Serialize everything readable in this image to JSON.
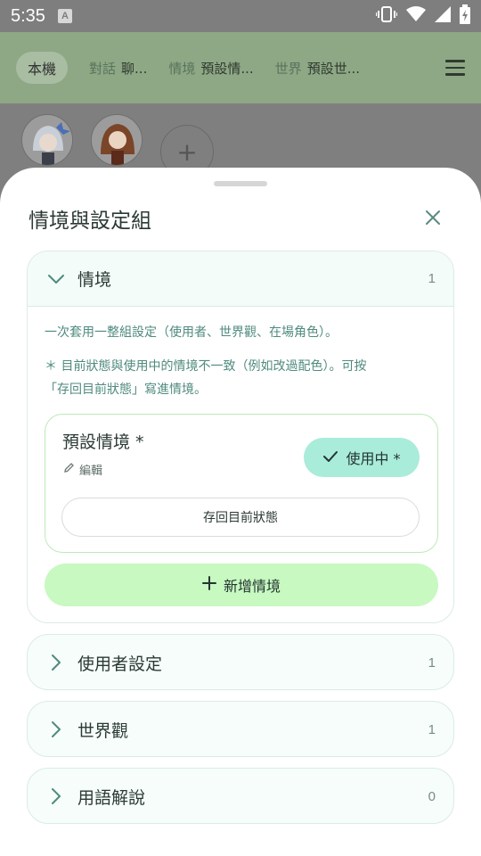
{
  "status": {
    "time": "5:35",
    "notif_letter": "A"
  },
  "header": {
    "tabs": [
      {
        "label": "本機"
      },
      {
        "key": "對話",
        "value": "聊..."
      },
      {
        "key": "情境",
        "value": "預設情..."
      },
      {
        "key": "世界",
        "value": "預設世..."
      }
    ]
  },
  "characters": {
    "add": "+"
  },
  "sheet": {
    "title": "情境與設定組",
    "sections": [
      {
        "label": "情境",
        "count": "1",
        "expanded": true
      },
      {
        "label": "使用者設定",
        "count": "1"
      },
      {
        "label": "世界觀",
        "count": "1"
      },
      {
        "label": "用語解說",
        "count": "0"
      }
    ],
    "scenario": {
      "desc1": "一次套用一整組設定（使用者、世界觀、在場角色）。",
      "warn_line1": "＊ 目前狀態與使用中的情境不一致（例如改過配色）。可按",
      "warn_line2": "「存回目前狀態」寫進情境。",
      "card": {
        "name": "預設情境 *",
        "edit": "編輯",
        "in_use": "使用中 *",
        "save_back": "存回目前狀態"
      },
      "add_new": "新增情境"
    }
  },
  "colors": {
    "accent": "#a9ecd9",
    "new_button": "#c7f9c1",
    "card_border": "#bdeab8"
  }
}
